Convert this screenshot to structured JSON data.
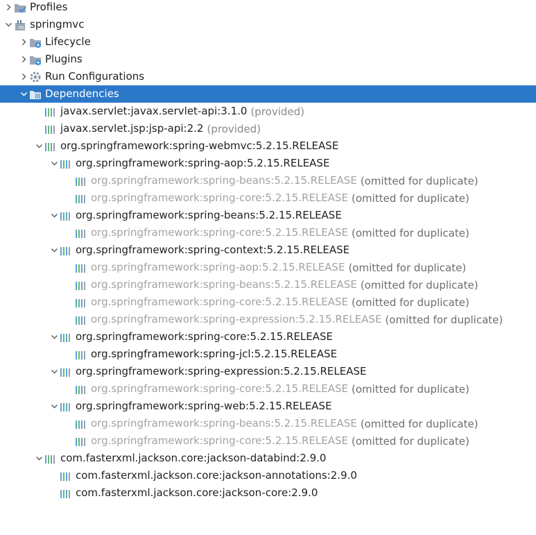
{
  "colors": {
    "selection": "#2c78c8",
    "omitted": "#a3a3a3",
    "folder": "#9aa7b5",
    "gear": "#3b8fe0",
    "lib": "#5aa4d6"
  },
  "tree": [
    {
      "label": "Profiles",
      "suffix": "",
      "level": 0,
      "arrow": "collapsed",
      "icon": "profiles-folder-icon",
      "selected": false,
      "omitted": false
    },
    {
      "label": "springmvc",
      "suffix": "",
      "level": 0,
      "arrow": "expanded",
      "icon": "maven-project-icon",
      "selected": false,
      "omitted": false
    },
    {
      "label": "Lifecycle",
      "suffix": "",
      "level": 1,
      "arrow": "collapsed",
      "icon": "lifecycle-folder-icon",
      "selected": false,
      "omitted": false
    },
    {
      "label": "Plugins",
      "suffix": "",
      "level": 1,
      "arrow": "collapsed",
      "icon": "plugins-folder-icon",
      "selected": false,
      "omitted": false
    },
    {
      "label": "Run Configurations",
      "suffix": "",
      "level": 1,
      "arrow": "collapsed",
      "icon": "gear-icon",
      "selected": false,
      "omitted": false
    },
    {
      "label": "Dependencies",
      "suffix": "",
      "level": 1,
      "arrow": "expanded",
      "icon": "dependencies-folder-icon",
      "selected": true,
      "omitted": false
    },
    {
      "label": "javax.servlet:javax.servlet-api:3.1.0",
      "suffix": "(provided)",
      "level": 2,
      "arrow": "none",
      "icon": "library-icon",
      "selected": false,
      "omitted": false
    },
    {
      "label": "javax.servlet.jsp:jsp-api:2.2",
      "suffix": "(provided)",
      "level": 2,
      "arrow": "none",
      "icon": "library-icon",
      "selected": false,
      "omitted": false
    },
    {
      "label": "org.springframework:spring-webmvc:5.2.15.RELEASE",
      "suffix": "",
      "level": 2,
      "arrow": "expanded",
      "icon": "library-icon",
      "selected": false,
      "omitted": false
    },
    {
      "label": "org.springframework:spring-aop:5.2.15.RELEASE",
      "suffix": "",
      "level": 3,
      "arrow": "expanded",
      "icon": "library-icon",
      "selected": false,
      "omitted": false
    },
    {
      "label": "org.springframework:spring-beans:5.2.15.RELEASE",
      "suffix": "(omitted for duplicate)",
      "level": 4,
      "arrow": "none",
      "icon": "library-icon",
      "selected": false,
      "omitted": true
    },
    {
      "label": "org.springframework:spring-core:5.2.15.RELEASE",
      "suffix": "(omitted for duplicate)",
      "level": 4,
      "arrow": "none",
      "icon": "library-icon",
      "selected": false,
      "omitted": true
    },
    {
      "label": "org.springframework:spring-beans:5.2.15.RELEASE",
      "suffix": "",
      "level": 3,
      "arrow": "expanded",
      "icon": "library-icon",
      "selected": false,
      "omitted": false
    },
    {
      "label": "org.springframework:spring-core:5.2.15.RELEASE",
      "suffix": "(omitted for duplicate)",
      "level": 4,
      "arrow": "none",
      "icon": "library-icon",
      "selected": false,
      "omitted": true
    },
    {
      "label": "org.springframework:spring-context:5.2.15.RELEASE",
      "suffix": "",
      "level": 3,
      "arrow": "expanded",
      "icon": "library-icon",
      "selected": false,
      "omitted": false
    },
    {
      "label": "org.springframework:spring-aop:5.2.15.RELEASE",
      "suffix": "(omitted for duplicate)",
      "level": 4,
      "arrow": "none",
      "icon": "library-icon",
      "selected": false,
      "omitted": true
    },
    {
      "label": "org.springframework:spring-beans:5.2.15.RELEASE",
      "suffix": "(omitted for duplicate)",
      "level": 4,
      "arrow": "none",
      "icon": "library-icon",
      "selected": false,
      "omitted": true
    },
    {
      "label": "org.springframework:spring-core:5.2.15.RELEASE",
      "suffix": "(omitted for duplicate)",
      "level": 4,
      "arrow": "none",
      "icon": "library-icon",
      "selected": false,
      "omitted": true
    },
    {
      "label": "org.springframework:spring-expression:5.2.15.RELEASE",
      "suffix": "(omitted for duplicate)",
      "level": 4,
      "arrow": "none",
      "icon": "library-icon",
      "selected": false,
      "omitted": true
    },
    {
      "label": "org.springframework:spring-core:5.2.15.RELEASE",
      "suffix": "",
      "level": 3,
      "arrow": "expanded",
      "icon": "library-icon",
      "selected": false,
      "omitted": false
    },
    {
      "label": "org.springframework:spring-jcl:5.2.15.RELEASE",
      "suffix": "",
      "level": 4,
      "arrow": "none",
      "icon": "library-icon",
      "selected": false,
      "omitted": false
    },
    {
      "label": "org.springframework:spring-expression:5.2.15.RELEASE",
      "suffix": "",
      "level": 3,
      "arrow": "expanded",
      "icon": "library-icon",
      "selected": false,
      "omitted": false
    },
    {
      "label": "org.springframework:spring-core:5.2.15.RELEASE",
      "suffix": "(omitted for duplicate)",
      "level": 4,
      "arrow": "none",
      "icon": "library-icon",
      "selected": false,
      "omitted": true
    },
    {
      "label": "org.springframework:spring-web:5.2.15.RELEASE",
      "suffix": "",
      "level": 3,
      "arrow": "expanded",
      "icon": "library-icon",
      "selected": false,
      "omitted": false
    },
    {
      "label": "org.springframework:spring-beans:5.2.15.RELEASE",
      "suffix": "(omitted for duplicate)",
      "level": 4,
      "arrow": "none",
      "icon": "library-icon",
      "selected": false,
      "omitted": true
    },
    {
      "label": "org.springframework:spring-core:5.2.15.RELEASE",
      "suffix": "(omitted for duplicate)",
      "level": 4,
      "arrow": "none",
      "icon": "library-icon",
      "selected": false,
      "omitted": true
    },
    {
      "label": "com.fasterxml.jackson.core:jackson-databind:2.9.0",
      "suffix": "",
      "level": 2,
      "arrow": "expanded",
      "icon": "library-icon",
      "selected": false,
      "omitted": false
    },
    {
      "label": "com.fasterxml.jackson.core:jackson-annotations:2.9.0",
      "suffix": "",
      "level": 3,
      "arrow": "none",
      "icon": "library-icon",
      "selected": false,
      "omitted": false
    },
    {
      "label": "com.fasterxml.jackson.core:jackson-core:2.9.0",
      "suffix": "",
      "level": 3,
      "arrow": "none",
      "icon": "library-icon",
      "selected": false,
      "omitted": false
    }
  ]
}
